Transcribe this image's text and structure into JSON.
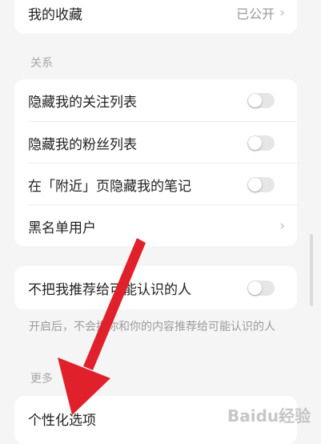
{
  "favorites": {
    "label": "我的收藏",
    "value": "已公开"
  },
  "relations": {
    "section_title": "关系",
    "items": [
      {
        "label": "隐藏我的关注列表"
      },
      {
        "label": "隐藏我的粉丝列表"
      },
      {
        "label": "在「附近」页隐藏我的笔记"
      },
      {
        "label": "黑名单用户"
      }
    ]
  },
  "recommend": {
    "label": "不把我推荐给可能认识的人",
    "note": "开启后，不会把你和你的内容推荐给可能认识的人"
  },
  "more": {
    "section_title": "更多",
    "items": [
      {
        "label": "个性化选项"
      }
    ]
  },
  "watermark": "Baidu经验",
  "colors": {
    "arrow": "#e0212b",
    "toggle_off": "#e6e6e6",
    "background": "#f5f5f5"
  }
}
